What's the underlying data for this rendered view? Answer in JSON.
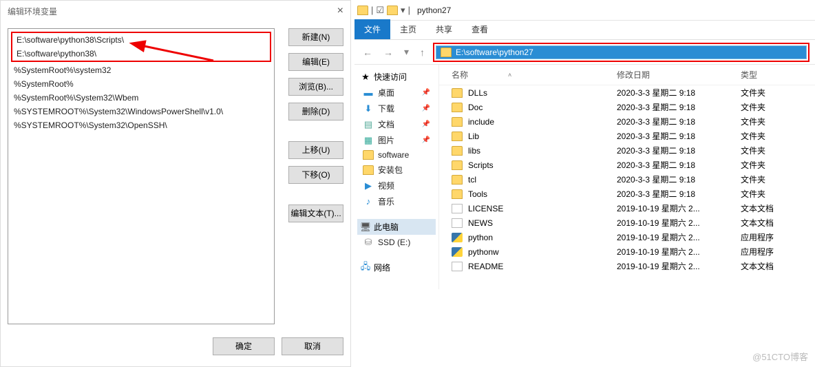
{
  "env_dialog": {
    "title": "编辑环境变量",
    "paths_highlighted": [
      "E:\\software\\python38\\Scripts\\",
      "E:\\software\\python38\\"
    ],
    "paths": [
      "%SystemRoot%\\system32",
      "%SystemRoot%",
      "%SystemRoot%\\System32\\Wbem",
      "%SYSTEMROOT%\\System32\\WindowsPowerShell\\v1.0\\",
      "%SYSTEMROOT%\\System32\\OpenSSH\\"
    ],
    "buttons": {
      "new": "新建(N)",
      "edit": "编辑(E)",
      "browse": "浏览(B)...",
      "delete": "删除(D)",
      "up": "上移(U)",
      "down": "下移(O)",
      "edit_text": "编辑文本(T)...",
      "ok": "确定",
      "cancel": "取消"
    }
  },
  "explorer": {
    "window_title": "python27",
    "ribbon": {
      "file": "文件",
      "home": "主页",
      "share": "共享",
      "view": "查看"
    },
    "address": "E:\\software\\python27",
    "nav": {
      "quick_access": "快速访问",
      "desktop": "桌面",
      "downloads": "下载",
      "documents": "文档",
      "pictures": "图片",
      "software": "software",
      "install": "安装包",
      "videos": "视频",
      "music": "音乐",
      "this_pc": "此电脑",
      "ssd": "SSD (E:)",
      "network": "网络"
    },
    "cols": {
      "name": "名称",
      "date": "修改日期",
      "type": "类型"
    },
    "rows": [
      {
        "name": "DLLs",
        "date": "2020-3-3 星期二 9:18",
        "type": "文件夹",
        "icon": "folder"
      },
      {
        "name": "Doc",
        "date": "2020-3-3 星期二 9:18",
        "type": "文件夹",
        "icon": "folder"
      },
      {
        "name": "include",
        "date": "2020-3-3 星期二 9:18",
        "type": "文件夹",
        "icon": "folder"
      },
      {
        "name": "Lib",
        "date": "2020-3-3 星期二 9:18",
        "type": "文件夹",
        "icon": "folder"
      },
      {
        "name": "libs",
        "date": "2020-3-3 星期二 9:18",
        "type": "文件夹",
        "icon": "folder"
      },
      {
        "name": "Scripts",
        "date": "2020-3-3 星期二 9:18",
        "type": "文件夹",
        "icon": "folder"
      },
      {
        "name": "tcl",
        "date": "2020-3-3 星期二 9:18",
        "type": "文件夹",
        "icon": "folder"
      },
      {
        "name": "Tools",
        "date": "2020-3-3 星期二 9:18",
        "type": "文件夹",
        "icon": "folder"
      },
      {
        "name": "LICENSE",
        "date": "2019-10-19 星期六 2...",
        "type": "文本文档",
        "icon": "file"
      },
      {
        "name": "NEWS",
        "date": "2019-10-19 星期六 2...",
        "type": "文本文档",
        "icon": "file"
      },
      {
        "name": "python",
        "date": "2019-10-19 星期六 2...",
        "type": "应用程序",
        "icon": "py"
      },
      {
        "name": "pythonw",
        "date": "2019-10-19 星期六 2...",
        "type": "应用程序",
        "icon": "py"
      },
      {
        "name": "README",
        "date": "2019-10-19 星期六 2...",
        "type": "文本文档",
        "icon": "file"
      }
    ]
  },
  "watermark": "@51CTO博客"
}
